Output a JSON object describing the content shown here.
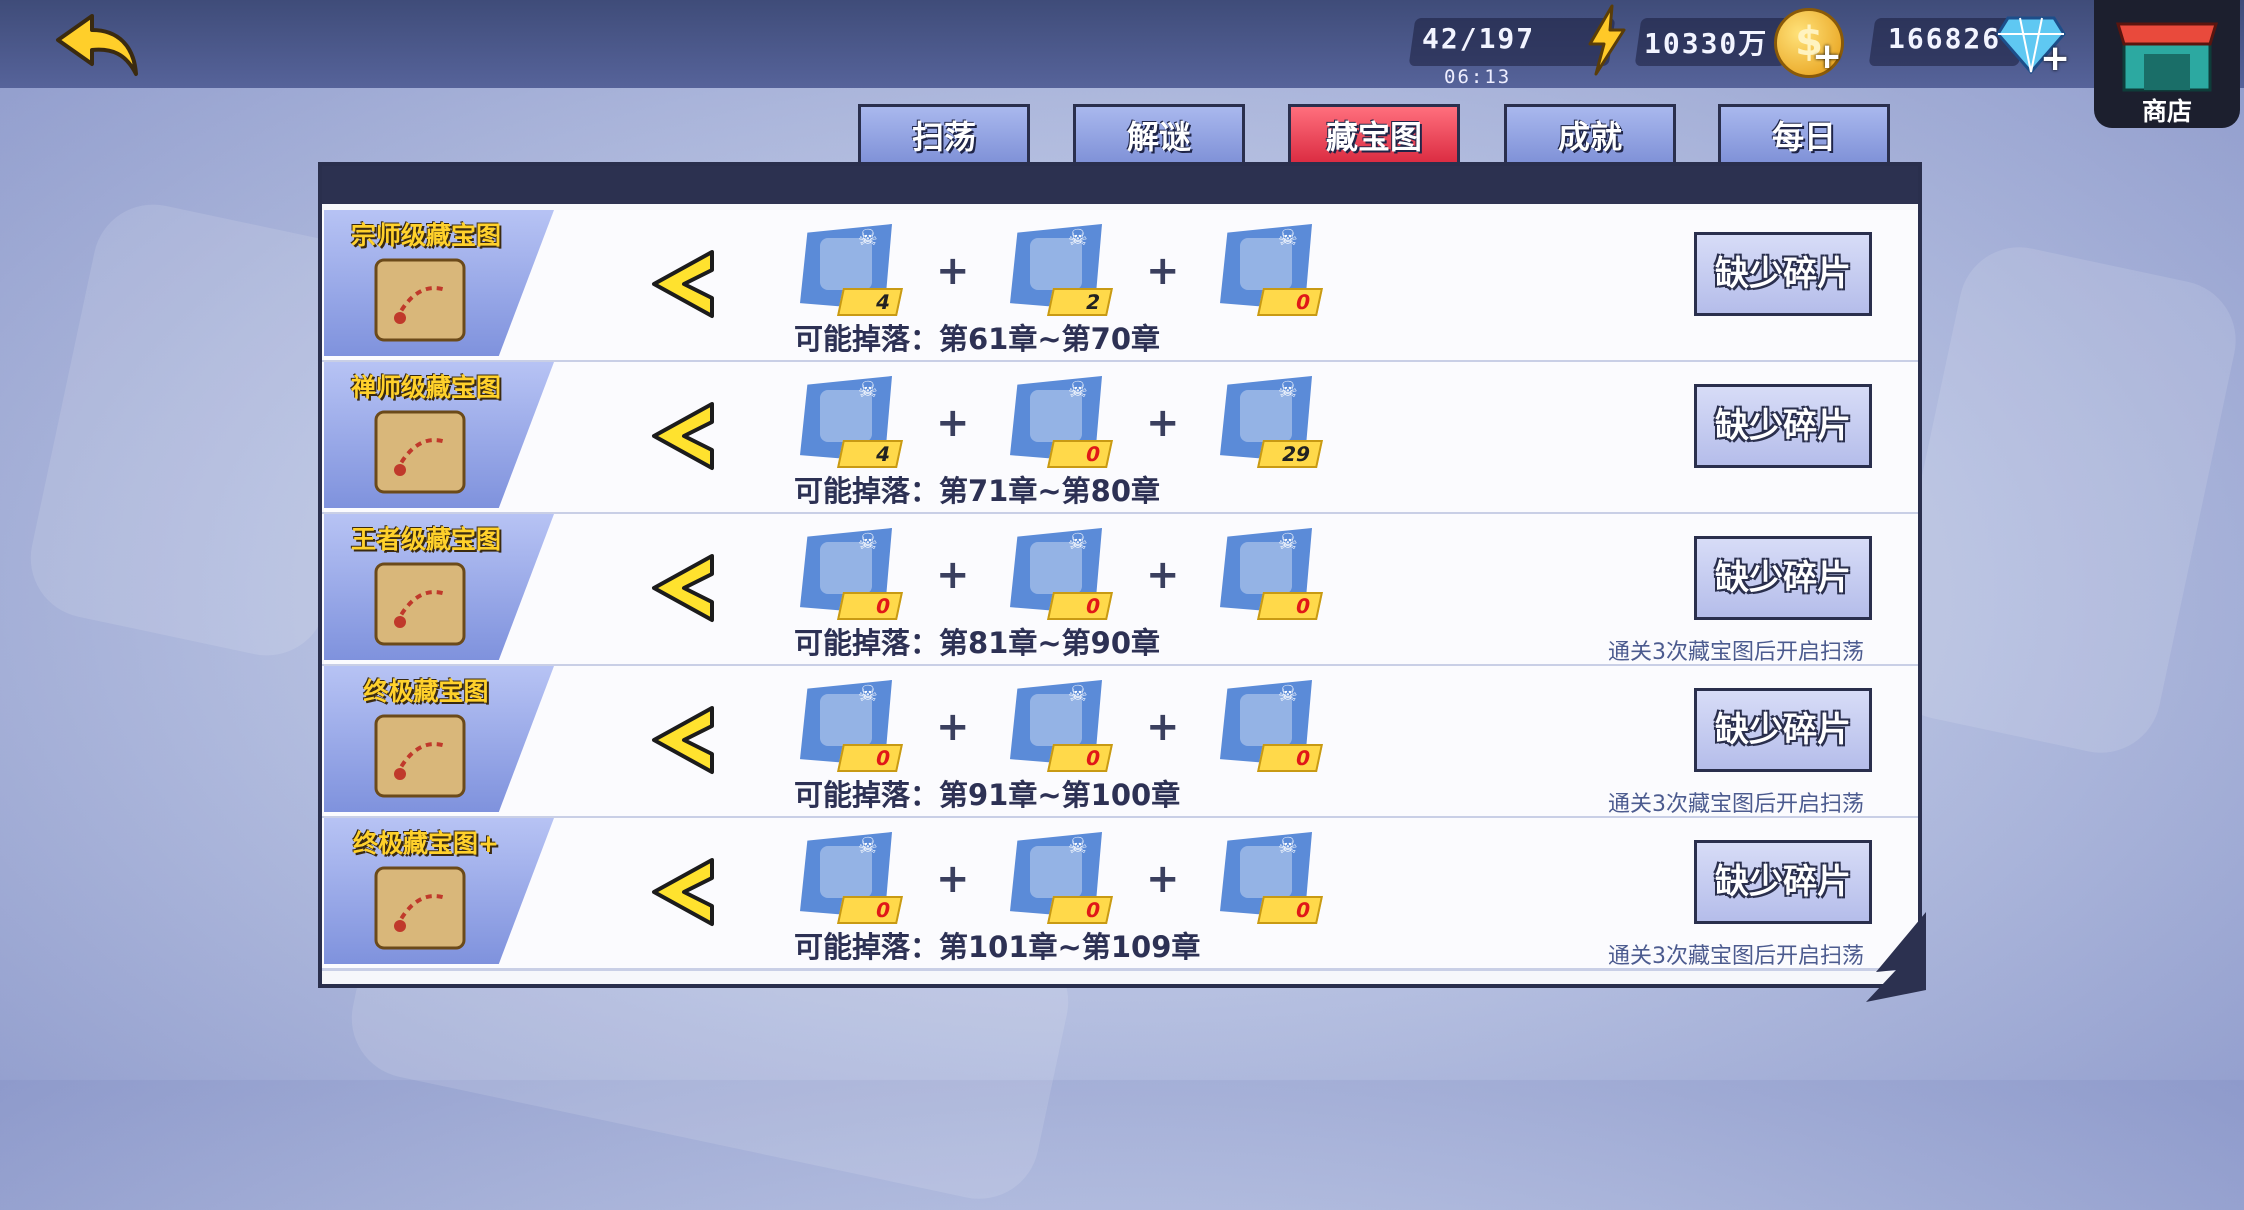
{
  "topbar": {
    "energy": "42/197",
    "timer": "06:13",
    "gold": "10330万",
    "diamonds": "166826",
    "shop_label": "商店"
  },
  "tabs": [
    {
      "label": "扫荡",
      "active": false
    },
    {
      "label": "解谜",
      "active": false
    },
    {
      "label": "藏宝图",
      "active": true
    },
    {
      "label": "成就",
      "active": false
    },
    {
      "label": "每日",
      "active": false
    }
  ],
  "rows": [
    {
      "title": "宗师级藏宝图",
      "drop": "可能掉落：第61章~第70章",
      "button": "缺少碎片",
      "note": "",
      "items": [
        {
          "icon": "cigar-icon",
          "count": "4"
        },
        {
          "icon": "bottle-icon",
          "count": "2"
        },
        {
          "icon": "barrel-icon",
          "count": "0"
        }
      ]
    },
    {
      "title": "禅师级藏宝图",
      "drop": "可能掉落：第71章~第80章",
      "button": "缺少碎片",
      "note": "",
      "items": [
        {
          "icon": "silver-coins-icon",
          "count": "4"
        },
        {
          "icon": "jade-coins-icon",
          "count": "0"
        },
        {
          "icon": "cash-stack-icon",
          "count": "29"
        }
      ]
    },
    {
      "title": "王者级藏宝图",
      "drop": "可能掉落：第81章~第90章",
      "button": "缺少碎片",
      "note": "通关3次藏宝图后开启扫荡",
      "items": [
        {
          "icon": "map-fragment-1-icon",
          "count": "0"
        },
        {
          "icon": "map-fragment-2-icon",
          "count": "0"
        },
        {
          "icon": "map-fragment-3-icon",
          "count": "0"
        }
      ]
    },
    {
      "title": "终极藏宝图",
      "drop": "可能掉落：第91章~第100章",
      "button": "缺少碎片",
      "note": "通关3次藏宝图后开启扫荡",
      "items": [
        {
          "icon": "map-fragment-1-icon",
          "count": "0"
        },
        {
          "icon": "map-fragment-2-icon",
          "count": "0"
        },
        {
          "icon": "map-fragment-3-icon",
          "count": "0"
        }
      ]
    },
    {
      "title": "终极藏宝图+",
      "drop": "可能掉落：第101章~第109章",
      "button": "缺少碎片",
      "note": "通关3次藏宝图后开启扫荡",
      "items": [
        {
          "icon": "green-map-fragment-1-icon",
          "count": "0"
        },
        {
          "icon": "green-map-fragment-2-icon",
          "count": "0"
        },
        {
          "icon": "green-map-fragment-3-icon",
          "count": "0"
        }
      ]
    }
  ],
  "colors": {
    "accent_tab": "#e0344a",
    "count_zero": "#e01818",
    "title_gold": "#ffd12b"
  }
}
